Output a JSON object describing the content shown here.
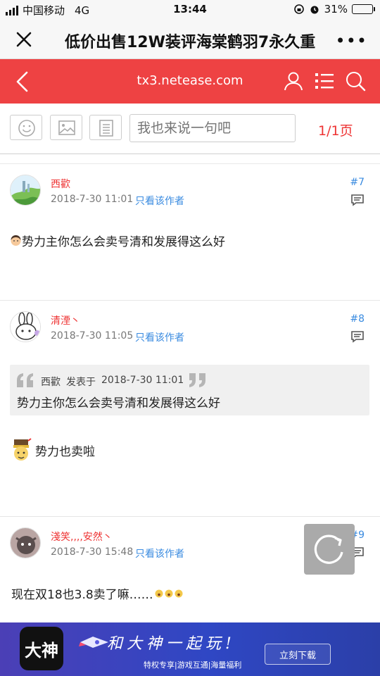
{
  "status_bar": {
    "carrier": "中国移动",
    "network": "4G",
    "time": "13:44",
    "battery_percent_text": "31%",
    "battery_level": 0.31
  },
  "title_bar": {
    "title": "低价出售12W装评海棠鹤羽7永久重",
    "close_icon": "close-icon",
    "more_icon": "more-dots-icon"
  },
  "nav": {
    "domain": "tx3.netease.com",
    "color": "#ee4243",
    "icons": [
      "back-arrow-icon",
      "user-icon",
      "list-icon",
      "search-icon"
    ]
  },
  "toolbar": {
    "buttons": [
      "emoji-icon",
      "image-icon",
      "document-icon"
    ],
    "reply_placeholder": "我也来说一句吧",
    "page_indicator": "1/1页"
  },
  "posts": [
    {
      "author": "西歡",
      "date": "2018-7-30 11:01",
      "only_author_link": "只看该作者",
      "floor": "#7",
      "content": "势力主你怎么会卖号清和发展得这么好",
      "emoji": "woman-face-emoji"
    },
    {
      "author": "清湮丶",
      "date": "2018-7-30 11:05",
      "only_author_link": "只看该作者",
      "floor": "#8",
      "quote": {
        "author": "西歡",
        "posted_at_label": "发表于",
        "date": "2018-7-30 11:01",
        "text": "势力主你怎么会卖号清和发展得这么好"
      },
      "content": "势力也卖啦",
      "emoji": "sticker-emoji"
    },
    {
      "author": "淺笑,,,,安然丶",
      "date": "2018-7-30 15:48",
      "only_author_link": "只看该作者",
      "floor": "#9",
      "content": "现在双18也3.8卖了嘛……",
      "emoji": "surprised-emoji"
    }
  ],
  "ad": {
    "app_name": "大神",
    "slogan": "和大神一起玩!",
    "subtitle": "特权专享|游戏互通|海量福利",
    "button": "立刻下载"
  },
  "colors": {
    "accent": "#ee4243",
    "link_blue": "#3a8be0",
    "username_red": "#e33"
  }
}
